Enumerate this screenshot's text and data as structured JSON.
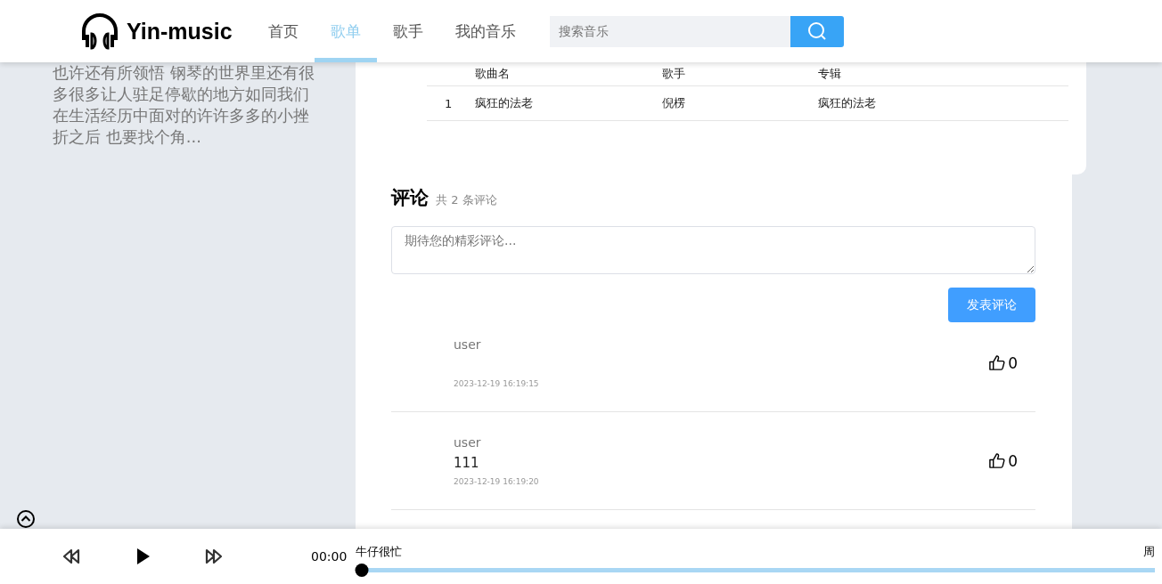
{
  "header": {
    "logo": "Yin-music",
    "nav": [
      {
        "label": "首页",
        "selected": false
      },
      {
        "label": "歌单",
        "selected": true
      },
      {
        "label": "歌手",
        "selected": false
      },
      {
        "label": "我的音乐",
        "selected": false
      }
    ],
    "search": {
      "placeholder": "搜索音乐"
    }
  },
  "sidebar": {
    "description": "也许还有所领悟 钢琴的世界里还有很多很多让人驻足停歇的地方如同我们在生活经历中面对的许许多多的小挫折之后 也要找个角..."
  },
  "song_table": {
    "columns": [
      "歌曲名",
      "歌手",
      "专辑"
    ],
    "rows": [
      {
        "index": "1",
        "title": "疯狂的法老",
        "singer": "倪楞",
        "album": "疯狂的法老"
      }
    ]
  },
  "comments": {
    "title": "评论",
    "count": "共 2 条评论",
    "input": {
      "placeholder": "期待您的精彩评论..."
    },
    "submit": "发表评论",
    "items": [
      {
        "user": "user",
        "time": "2023-12-19 16:19:15",
        "likes": "0"
      },
      {
        "user": "user",
        "content": "111",
        "time": "2023-12-19 16:19:20",
        "likes": "0"
      }
    ]
  },
  "player": {
    "time": "00:00",
    "title": "牛仔很忙",
    "artist": "周",
    "level": 0
  }
}
